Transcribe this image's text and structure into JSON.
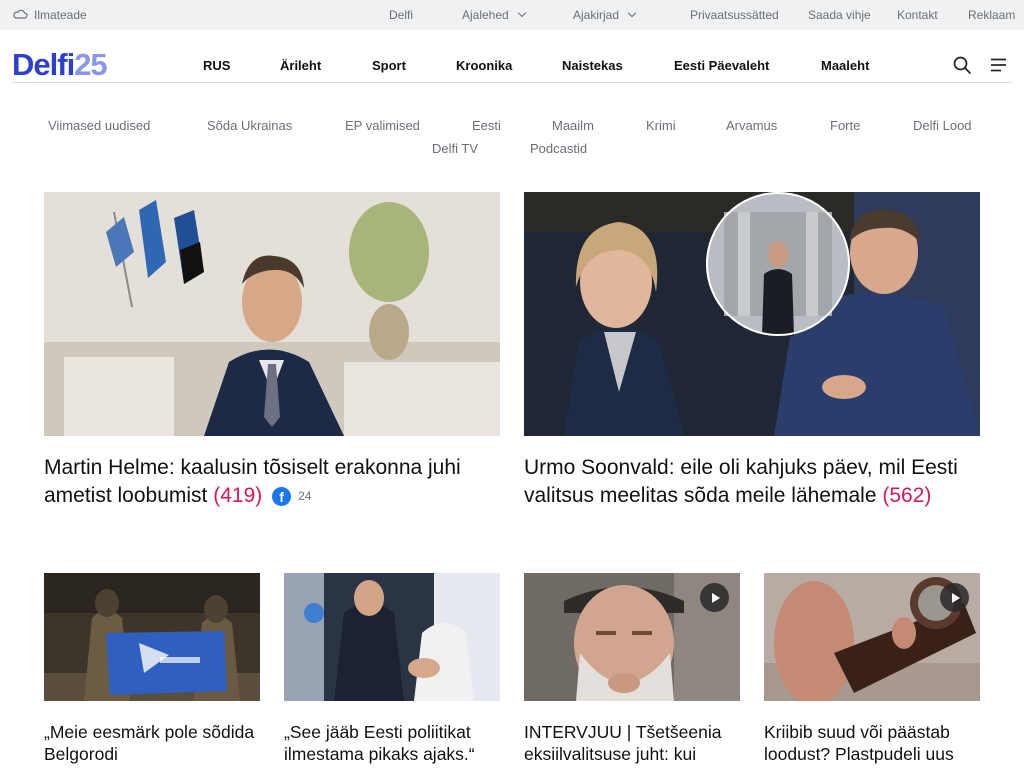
{
  "topbar": {
    "weather": "Ilmateade",
    "delfi": "Delfi",
    "newspapers": "Ajalehed",
    "magazines": "Ajakirjad",
    "privacy": "Privaatsussätted",
    "tip": "Saada vihje",
    "contact": "Kontakt",
    "ads": "Reklaam"
  },
  "logo": {
    "name": "Delfi",
    "number": "25"
  },
  "mainnav": [
    "RUS",
    "Ärileht",
    "Sport",
    "Kroonika",
    "Naistekas",
    "Eesti Päevaleht",
    "Maaleht"
  ],
  "subnav": [
    "Viimased uudised",
    "Sõda Ukrainas",
    "EP valimised",
    "Eesti",
    "Maailm",
    "Krimi",
    "Arvamus",
    "Forte",
    "Delfi Lood",
    "Delfi TV",
    "Podcastid"
  ],
  "featured": [
    {
      "title": "Martin Helme: kaalusin tõsiselt erakonna juhi ametist loobumist",
      "comments": "(419)",
      "facebook_count": "24"
    },
    {
      "title": "Urmo Soonvald: eile oli kahjuks päev, mil Eesti valitsus meelitas sõda meile lähemale",
      "comments": "(562)"
    }
  ],
  "articles": [
    {
      "title": "„Meie eesmärk pole sõdida Belgorodi"
    },
    {
      "title": "„See jääb Eesti poliitikat ilmestama pikaks ajaks.“"
    },
    {
      "title": "INTERVJUU | Tšetšeenia eksiilvalitsuse juht: kui"
    },
    {
      "title": "Kriibib suud või päästab loodust? Plastpudeli uus"
    }
  ],
  "colors": {
    "brand": "#2d3fd1",
    "comments": "#d6195b",
    "facebook": "#1877f2"
  }
}
